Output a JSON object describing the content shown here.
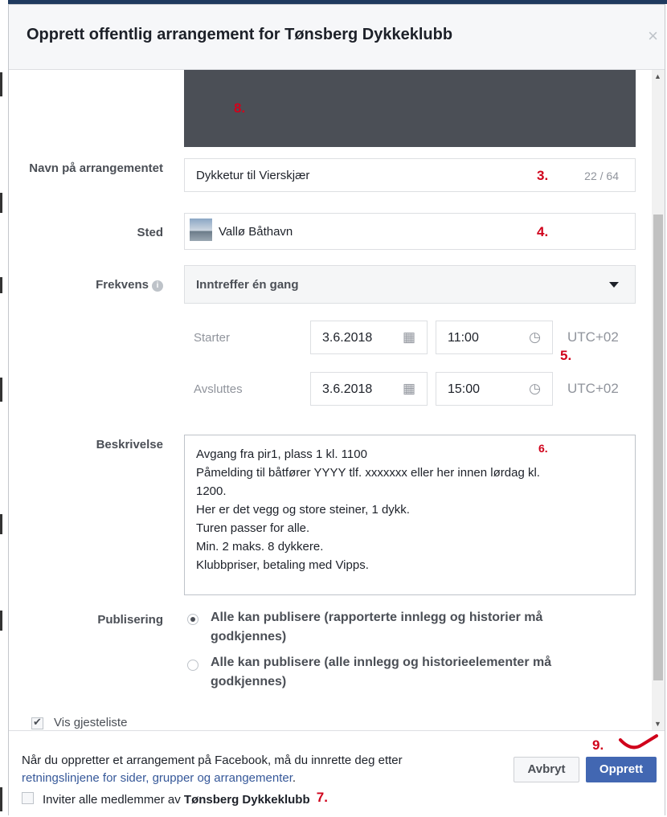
{
  "dialog": {
    "title": "Opprett offentlig arrangement for Tønsberg Dykkeklubb",
    "close_label": "×"
  },
  "annotations": {
    "cover": "8.",
    "name": "3.",
    "place": "4.",
    "time": "5.",
    "description": "6.",
    "invite": "7.",
    "create": "9."
  },
  "form": {
    "name_label": "Navn på arrangementet",
    "name_value": "Dykketur til Vierskjær",
    "name_counter": "22 / 64",
    "place_label": "Sted",
    "place_value": "Vallø Båthavn",
    "frequency_label": "Frekvens",
    "frequency_value": "Inntreffer én gang",
    "start_label": "Starter",
    "start_date": "3.6.2018",
    "start_time": "11:00",
    "start_tz": "UTC+02",
    "end_label": "Avsluttes",
    "end_date": "3.6.2018",
    "end_time": "15:00",
    "end_tz": "UTC+02",
    "description_label": "Beskrivelse",
    "description_lines": [
      "Avgang fra pir1, plass 1 kl. 1100",
      "Påmelding til båtfører YYYY tlf. xxxxxxx eller her innen lørdag kl.",
      "1200.",
      "Her er det vegg og store steiner, 1 dykk.",
      "Turen passer for alle.",
      "Min. 2 maks. 8 dykkere.",
      "Klubbpriser, betaling med Vipps."
    ],
    "publishing_label": "Publisering",
    "publishing_options": [
      {
        "line1": "Alle kan publisere (rapporterte innlegg og historier må",
        "line2": "godkjennes)",
        "selected": true
      },
      {
        "line1": "Alle kan publisere (alle innlegg og historieelementer må",
        "line2": "godkjennes)",
        "selected": false
      }
    ],
    "guestlist_label": "Vis gjesteliste",
    "guestlist_checked": true
  },
  "footer": {
    "notice_text": "Når du oppretter et arrangement på Facebook, må du innrette deg etter",
    "notice_link": "retningslinjene for sider, grupper og arrangementer",
    "notice_end": ".",
    "invite_prefix": "Inviter alle medlemmer av ",
    "invite_club": "Tønsberg Dykkeklubb",
    "invite_checked": false,
    "cancel_label": "Avbryt",
    "create_label": "Opprett"
  }
}
